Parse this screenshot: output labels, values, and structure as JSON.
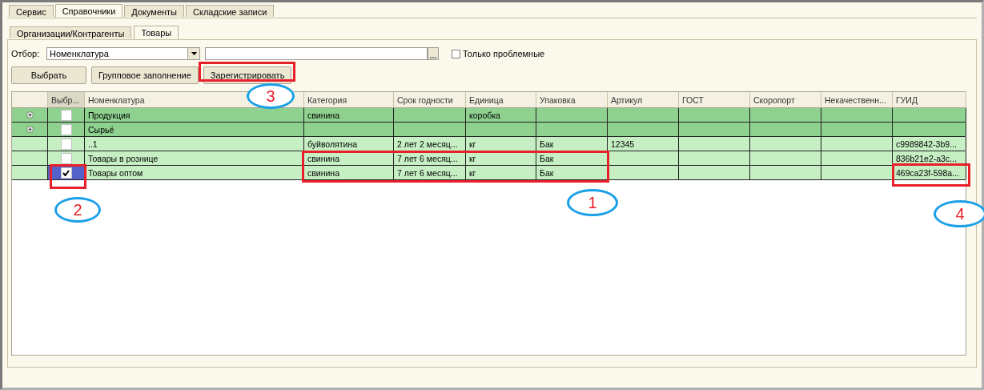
{
  "tabs": [
    {
      "label": "Сервис",
      "selected": false
    },
    {
      "label": "Справочники",
      "selected": true
    },
    {
      "label": "Документы",
      "selected": false
    },
    {
      "label": "Складские записи",
      "selected": false
    }
  ],
  "subtabs": [
    {
      "label": "Организации/Контрагенты",
      "selected": false
    },
    {
      "label": "Товары",
      "selected": true
    }
  ],
  "filter": {
    "label": "Отбор:",
    "value": "Номенклатура",
    "only_problems": {
      "label": "Только проблемные",
      "checked": false
    }
  },
  "buttons": [
    "Выбрать",
    "Групповое заполнение",
    "Зарегистрировать"
  ],
  "table": {
    "select_header": "Выбр...",
    "columns": [
      "Номенклатура",
      "Категория",
      "Срок годности",
      "Единица",
      "Упаковка",
      "Артикул",
      "ГОСТ",
      "Скоропорт",
      "Некачественн...",
      "ГУИД"
    ],
    "rows": [
      {
        "kind": "group",
        "checked": false,
        "selected": false,
        "cells": [
          "Продукция",
          "свинина",
          "",
          "коробка",
          "",
          "",
          "",
          "",
          "",
          ""
        ]
      },
      {
        "kind": "group",
        "checked": false,
        "selected": false,
        "cells": [
          "Сырьё",
          "",
          "",
          "",
          "",
          "",
          "",
          "",
          "",
          ""
        ]
      },
      {
        "kind": "item",
        "checked": false,
        "selected": false,
        "cells": [
          "..1",
          "буйволятина",
          "2 лет 2 месяц...",
          "кг",
          "Бак",
          "12345",
          "",
          "",
          "",
          "c9989842-3b9..."
        ]
      },
      {
        "kind": "item",
        "checked": false,
        "selected": false,
        "cells": [
          "Товары в рознице",
          "свинина",
          "7 лет 6 месяц...",
          "кг",
          "Бак",
          "",
          "",
          "",
          "",
          "836b21e2-a3c..."
        ]
      },
      {
        "kind": "item",
        "checked": true,
        "selected": true,
        "cells": [
          "Товары оптом",
          "свинина",
          "7 лет 6 месяц...",
          "кг",
          "Бак",
          "",
          "",
          "",
          "",
          "469ca23f-598a..."
        ]
      }
    ]
  },
  "callouts": [
    {
      "number": "1"
    },
    {
      "number": "2"
    },
    {
      "number": "3"
    },
    {
      "number": "4"
    }
  ]
}
